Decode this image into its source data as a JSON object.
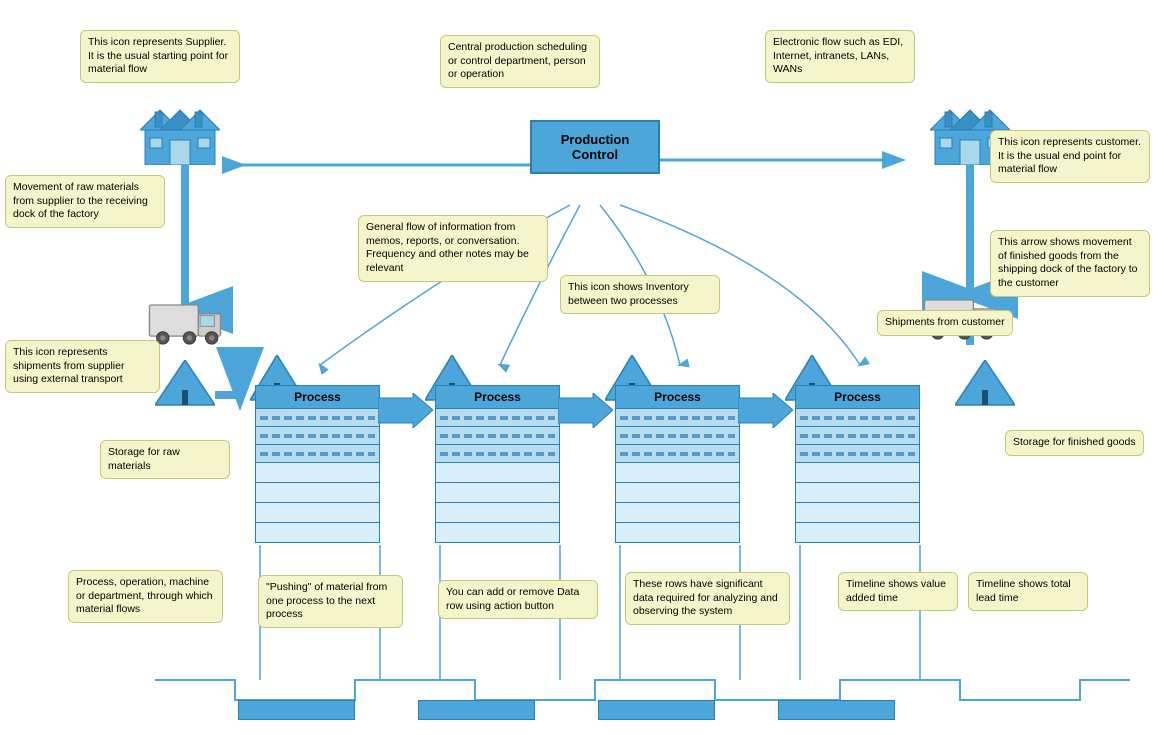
{
  "callouts": {
    "supplier_desc": "This icon represents Supplier. It is the usual starting point for material flow",
    "prod_control_desc": "Central production scheduling or control department, person or operation",
    "electronic_flow": "Electronic flow such as EDI, Internet, intranets, LANs, WANs",
    "customer_desc": "This icon represents customer. It is the usual end point for material flow",
    "raw_movement": "Movement of raw materials from supplier to the receiving dock of the factory",
    "info_flow": "General flow of information from memos, reports, or conversation. Frequency and other notes may be relevant",
    "inventory_icon": "This icon shows Inventory between two processes",
    "finished_movement": "This arrow shows movement of finished goods from the shipping dock of the factory to the customer",
    "shipments_customer": "Shipments from customer",
    "supplier_transport": "This icon represents shipments from supplier using external transport",
    "storage_raw": "Storage for raw materials",
    "storage_finished": "Storage for finished goods",
    "process_desc": "Process, operation, machine or department, through which material flows",
    "push_arrow": "\"Pushing\" of material from one process to the next process",
    "data_row": "You can add or remove Data row using action button",
    "significant_rows": "These rows have significant data required for analyzing and observing the system",
    "timeline_value": "Timeline shows value added time",
    "timeline_lead": "Timeline shows total lead time"
  },
  "process_labels": [
    "Process",
    "Process",
    "Process",
    "Process"
  ],
  "prod_control_label": "Production\nControl",
  "colors": {
    "blue": "#4da6d9",
    "blue_dark": "#2980b9",
    "callout_bg": "#f5f5cc",
    "callout_border": "#c8c87a"
  }
}
